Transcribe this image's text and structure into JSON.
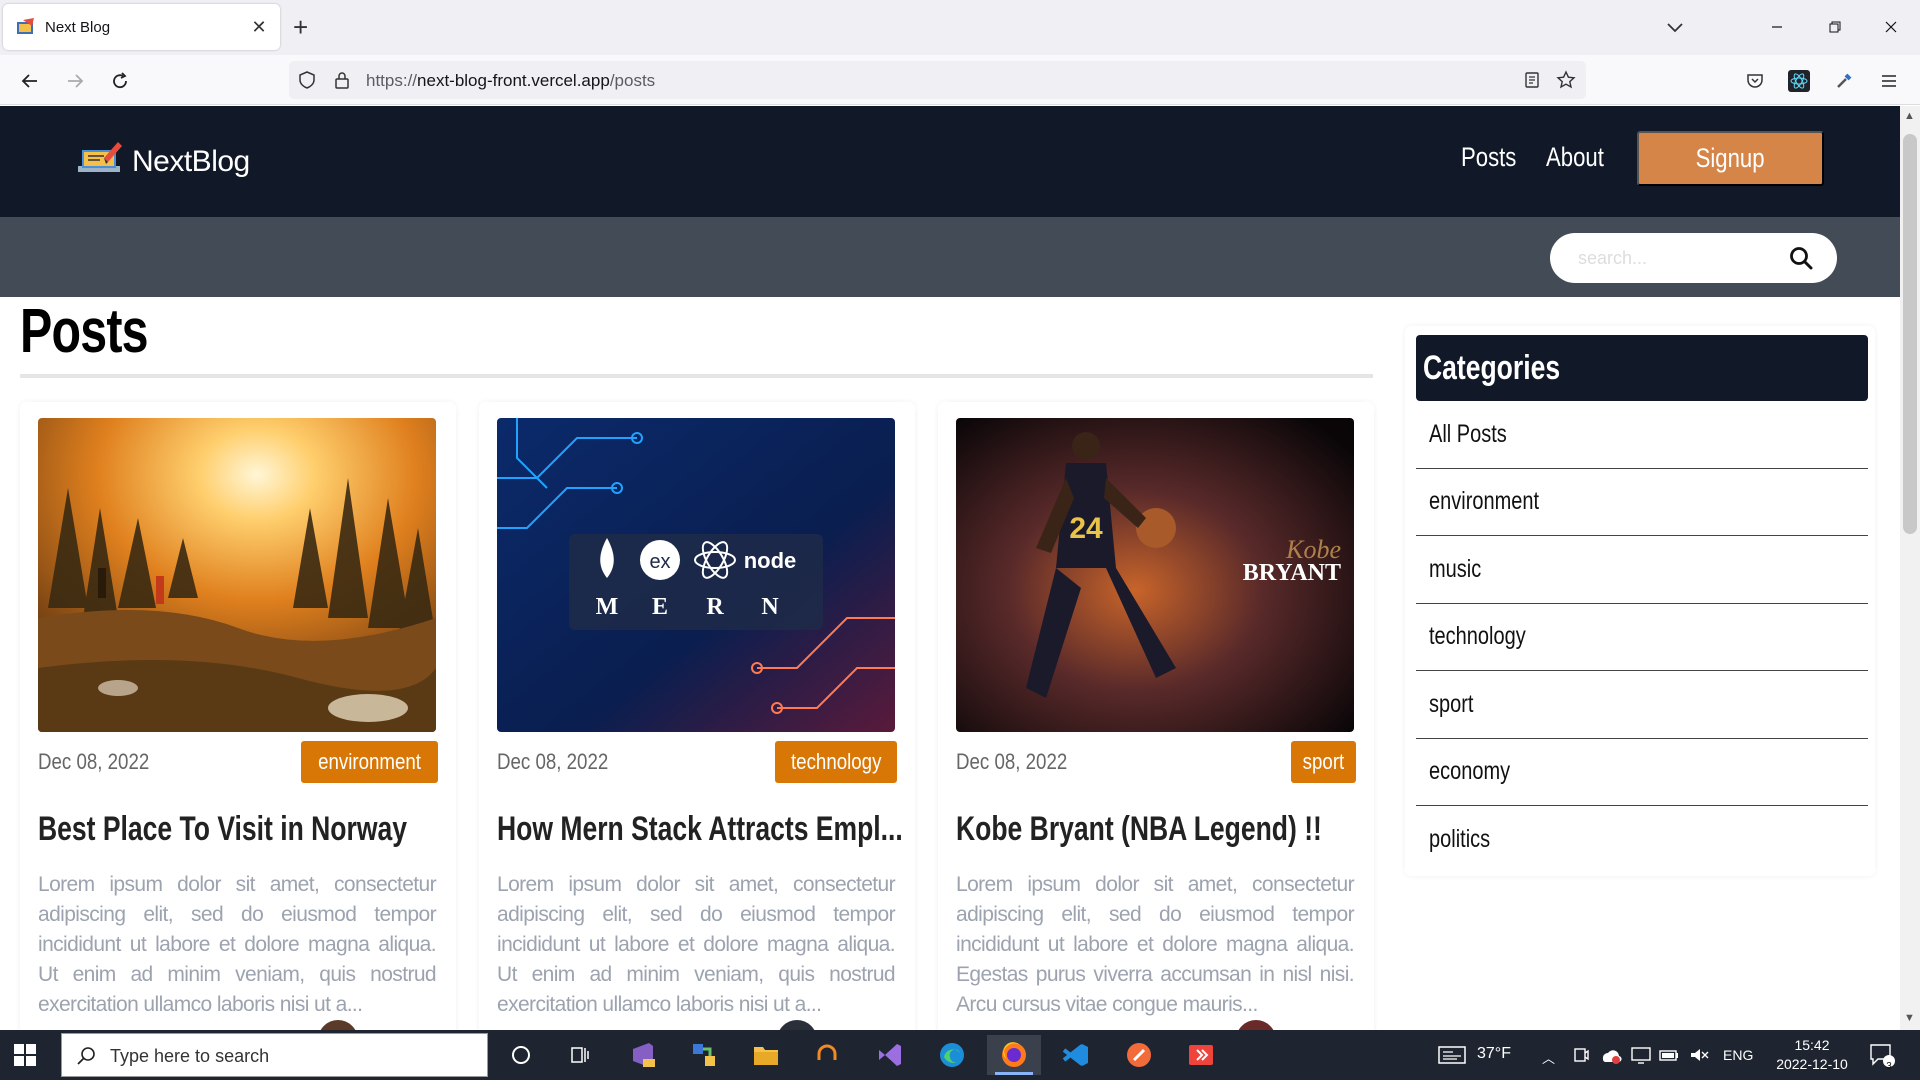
{
  "browser": {
    "tab_title": "Next Blog",
    "url_prefix": "https://",
    "url_host": "next-blog-front.vercel.app",
    "url_path": "/posts"
  },
  "site": {
    "logo_text": "NextBlog",
    "nav": [
      "Posts",
      "About"
    ],
    "signup_label": "Signup",
    "search_placeholder": "search...",
    "page_title": "Posts",
    "accent_color": "#d97706",
    "header_color": "#111827"
  },
  "posts": [
    {
      "date": "Dec 08, 2022",
      "category": "environment",
      "title": "Best Place To Visit in Norway",
      "excerpt": "Lorem ipsum dolor sit amet, consectetur adipiscing elit, sed do eiusmod tempor incididunt ut labore et dolore magna aliqua. Ut enim ad minim veniam, quis nostrud exercitation ullamco laboris nisi ut a..."
    },
    {
      "date": "Dec 08, 2022",
      "category": "technology",
      "title": "How Mern Stack Attracts Empl...",
      "excerpt": "Lorem ipsum dolor sit amet, consectetur adipiscing elit, sed do eiusmod tempor incididunt ut labore et dolore magna aliqua. Ut enim ad minim veniam, quis nostrud exercitation ullamco laboris nisi ut a...",
      "image_text": {
        "ex": "ex",
        "node": "node",
        "letters": [
          "M",
          "E",
          "R",
          "N"
        ]
      }
    },
    {
      "date": "Dec 08, 2022",
      "category": "sport",
      "title": "Kobe Bryant (NBA Legend) !!",
      "excerpt": "Lorem ipsum dolor sit amet, consectetur adipiscing elit, sed do eiusmod tempor incididunt ut labore et dolore magna aliqua. Egestas purus viverra accumsan in nisl nisi. Arcu cursus vitae congue mauris...",
      "image_text": {
        "script": "Kobe",
        "name": "BRYANT",
        "jersey": "24"
      }
    }
  ],
  "sidebar": {
    "title": "Categories",
    "items": [
      "All Posts",
      "environment",
      "music",
      "technology",
      "sport",
      "economy",
      "politics"
    ]
  },
  "taskbar": {
    "search_placeholder": "Type here to search",
    "weather": "37°F",
    "language": "ENG",
    "time": "15:42",
    "date": "2022-12-10",
    "notifications": "3"
  }
}
